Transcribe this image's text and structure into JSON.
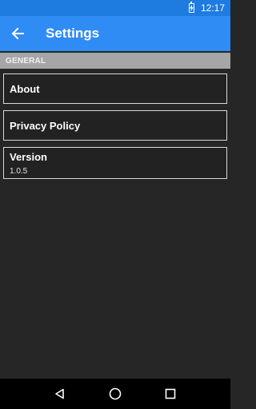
{
  "status_bar": {
    "time": "12:17"
  },
  "app_bar": {
    "title": "Settings"
  },
  "section": {
    "header": "GENERAL"
  },
  "preferences": [
    {
      "title": "About"
    },
    {
      "title": "Privacy Policy"
    },
    {
      "title": "Version",
      "summary": "1.0.5"
    }
  ],
  "colors": {
    "status_bar": "#1e7be0",
    "app_bar": "#2f8cf5",
    "background": "#262626",
    "section_header": "#a6a6a6"
  },
  "icons": {
    "back": "arrow-left-icon",
    "battery": "battery-charging-icon",
    "nav_back": "triangle-back-icon",
    "nav_home": "circle-home-icon",
    "nav_recents": "square-recents-icon"
  }
}
